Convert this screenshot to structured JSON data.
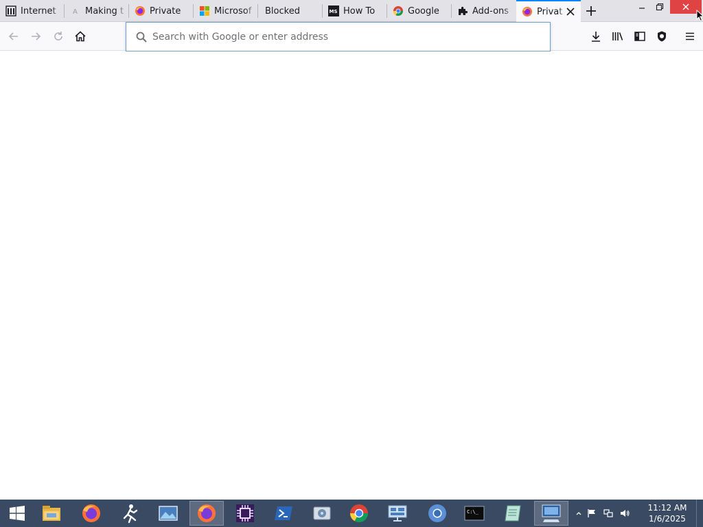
{
  "browser": {
    "tabs": [
      {
        "title": "Internet",
        "icon": "archive-icon"
      },
      {
        "title": "Making t",
        "icon": "a-icon"
      },
      {
        "title": "Private",
        "icon": "firefox-icon"
      },
      {
        "title": "Microsof",
        "icon": "microsoft-icon"
      },
      {
        "title": "Blocked",
        "icon": ""
      },
      {
        "title": "How To",
        "icon": "ms-icon"
      },
      {
        "title": "Google",
        "icon": "chrome-icon"
      },
      {
        "title": "Add-ons",
        "icon": "puzzle-icon"
      },
      {
        "title": "Privat",
        "icon": "firefox-icon",
        "active": true
      }
    ],
    "urlbar": {
      "placeholder": "Search with Google or enter address",
      "value": ""
    },
    "accent": "#0a84ff"
  },
  "taskbar": {
    "items": [
      "start-icon",
      "file-explorer-icon",
      "firefox-icon",
      "runner-icon",
      "photos-icon",
      "firefox-icon",
      "chip-icon",
      "powershell-icon",
      "disk-icon",
      "chrome-icon",
      "network-icon",
      "chromium-icon",
      "terminal-icon",
      "notepad-icon",
      "remote-desktop-icon"
    ],
    "clock": {
      "time": "11:12 AM",
      "date": "1/6/2025"
    }
  }
}
